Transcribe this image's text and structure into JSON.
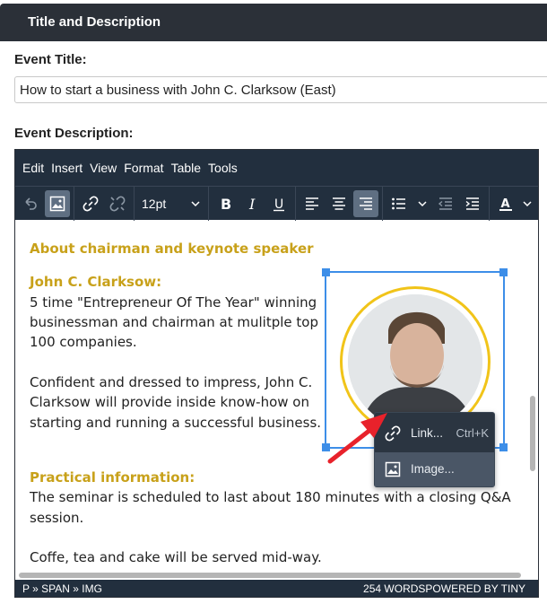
{
  "section": {
    "title": "Title and Description"
  },
  "event_title": {
    "label": "Event Title:",
    "value": "How to start a business with John C. Clarksow (East)"
  },
  "event_description": {
    "label": "Event Description:"
  },
  "editor": {
    "menu": [
      "Edit",
      "Insert",
      "View",
      "Format",
      "Table",
      "Tools"
    ],
    "font_size": "12pt",
    "content": {
      "heading1": "About chairman and keynote speaker",
      "heading2": "John C. Clarksow:",
      "para1_line1": "5 time \"Entrepreneur Of The Year\" winning",
      "para1_line2": "businessman and chairman at mulitple top",
      "para1_line3": "100 companies.",
      "para2_line1": "Confident and dressed to impress, John C.",
      "para2_line2": "Clarksow will provide inside know-how on",
      "para2_line3": "starting and running a successful business.",
      "heading3": "Practical information:",
      "para3_line1": "The seminar is scheduled to last about 180 minutes with a closing Q&A",
      "para3_line2": "session.",
      "para4": "Coffe, tea and cake will be served mid-way."
    },
    "context_menu": {
      "link_label": "Link...",
      "link_shortcut": "Ctrl+K",
      "image_label": "Image..."
    },
    "status": {
      "path": "P » SPAN » IMG",
      "words": "254 WORDS",
      "powered": "POWERED BY TINY"
    }
  },
  "colors": {
    "accent_heading": "#c8a11a",
    "toolbar_bg": "#222f3e",
    "selection_blue": "#3d8ee8",
    "arrow_red": "#e8222b"
  }
}
